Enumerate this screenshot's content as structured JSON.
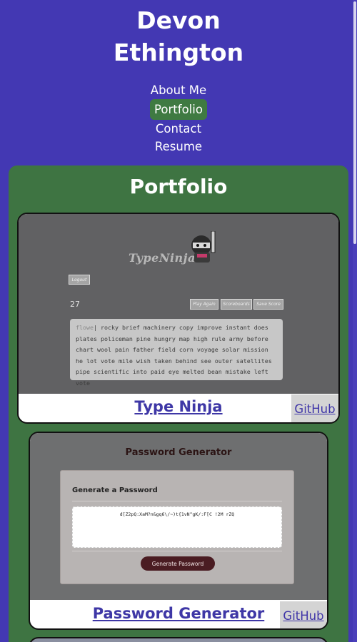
{
  "header": {
    "name_line1": "Devon",
    "name_line2": "Ethington"
  },
  "nav": {
    "items": [
      {
        "label": "About Me"
      },
      {
        "label": "Portfolio"
      },
      {
        "label": "Contact"
      },
      {
        "label": "Resume"
      }
    ],
    "active": "Portfolio"
  },
  "portfolio": {
    "title": "Portfolio",
    "projects": [
      {
        "title": "Type Ninja",
        "github_label": "GitHub",
        "screenshot": {
          "logo_text": "TypeNinja",
          "logout_label": "Logout",
          "count": "27",
          "buttons": [
            "Play Again",
            "Scoreboards",
            "Save Score"
          ],
          "typed": "flowe",
          "text": "rocky brief machinery copy improve instant does plates policeman pine hungry map high rule army before chart wool pain father field corn voyage solar mission he lot vote mile wish taken behind see outer satellites pipe scientific into paid eye melted bean mistake left vote"
        }
      },
      {
        "title": "Password Generator",
        "github_label": "GitHub",
        "screenshot": {
          "header": "Password Generator",
          "subheader": "Generate a Password",
          "password": "d[Z2pQ:XaM?n&gq6\\/~)t{1vN^gK/:F[C !2M rZQ",
          "button_label": "Generate Password"
        }
      }
    ]
  },
  "colors": {
    "page_bg": "#4338b3",
    "section_bg": "#3e7442",
    "nav_active_bg": "#3f7a42",
    "link": "#3e37a6"
  }
}
